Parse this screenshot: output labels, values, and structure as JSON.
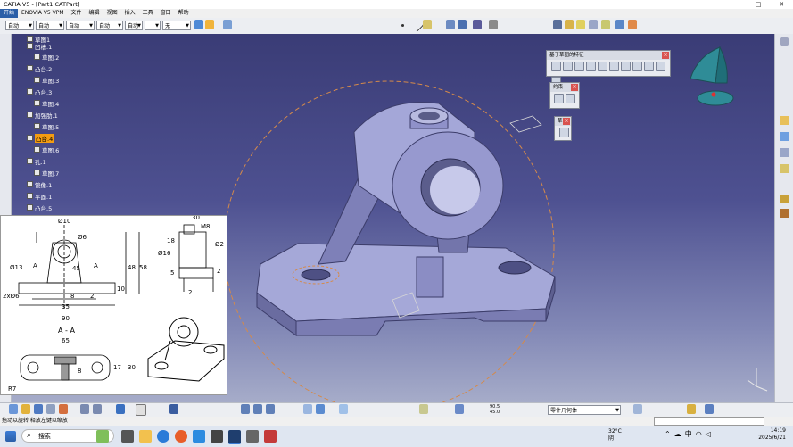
{
  "window": {
    "title": "CATIA V5 - [Part1.CATPart]",
    "controls": [
      "─",
      "□",
      "✕"
    ]
  },
  "menu": [
    "开始",
    "ENOVIA V5 VPM",
    "文件",
    "编辑",
    "视图",
    "插入",
    "工具",
    "窗口",
    "帮助"
  ],
  "toolbar_dropdowns": [
    "自动",
    "自动",
    "自动",
    "自动",
    "自动",
    "",
    "无"
  ],
  "tree": [
    {
      "label": "草图1",
      "kind": "sketch"
    },
    {
      "label": "凹槽.1",
      "kind": "feature"
    },
    {
      "label": "草图.2",
      "kind": "sketch"
    },
    {
      "label": "凸台.2",
      "kind": "feature"
    },
    {
      "label": "草图.3",
      "kind": "sketch"
    },
    {
      "label": "凸台.3",
      "kind": "feature"
    },
    {
      "label": "草图.4",
      "kind": "sketch"
    },
    {
      "label": "加强肋.1",
      "kind": "feature"
    },
    {
      "label": "草图.5",
      "kind": "sketch"
    },
    {
      "label": "凸台.4",
      "kind": "feature",
      "selected": true
    },
    {
      "label": "草图.6",
      "kind": "sketch"
    },
    {
      "label": "孔.1",
      "kind": "feature"
    },
    {
      "label": "草图.7",
      "kind": "sketch"
    },
    {
      "label": "镜像.1",
      "kind": "feature"
    },
    {
      "label": "平面.1",
      "kind": "feature"
    },
    {
      "label": "凸台.5",
      "kind": "feature"
    }
  ],
  "panels": {
    "sketch_features": {
      "title": "基于草图的特征",
      "close": "×"
    },
    "constraint": {
      "title": "约束",
      "close": "×"
    },
    "sketch": {
      "title": "草",
      "close": "×"
    }
  },
  "drawing_labels": {
    "d10": "Ø10",
    "r36": "Ø6",
    "d13": "Ø13",
    "A1": "A",
    "A2": "A",
    "hole": "2xØ6",
    "n45": "45",
    "n8": "8",
    "n2": "2",
    "n10": "10",
    "n35": "35",
    "n90": "90",
    "n48": "48",
    "n58": "58",
    "n30": "30",
    "m8": "M8",
    "n18": "18",
    "n16": "Ø16",
    "n5": "5",
    "n2b": "2",
    "d2": "Ø2",
    "n2c": "2",
    "section": "A - A",
    "n65": "65",
    "n17": "17",
    "n30b": "30",
    "n8b": "8",
    "r7": "R7"
  },
  "bottom_dropdown": "零件几何体",
  "coords": [
    "90.5",
    "45.0"
  ],
  "status": {
    "text": "拖动以旋转 释放左键以缩放"
  },
  "taskbar": {
    "search_placeholder": "搜索",
    "weather_temp": "32°C",
    "weather_desc": "阴",
    "time": "14:19",
    "date": "2025/6/21",
    "ime": "中"
  },
  "colors": {
    "viewport_top": "#3a3c76",
    "viewport_bottom": "#a6acc9",
    "part": "#8f91c9",
    "selection": "#f39c12"
  }
}
